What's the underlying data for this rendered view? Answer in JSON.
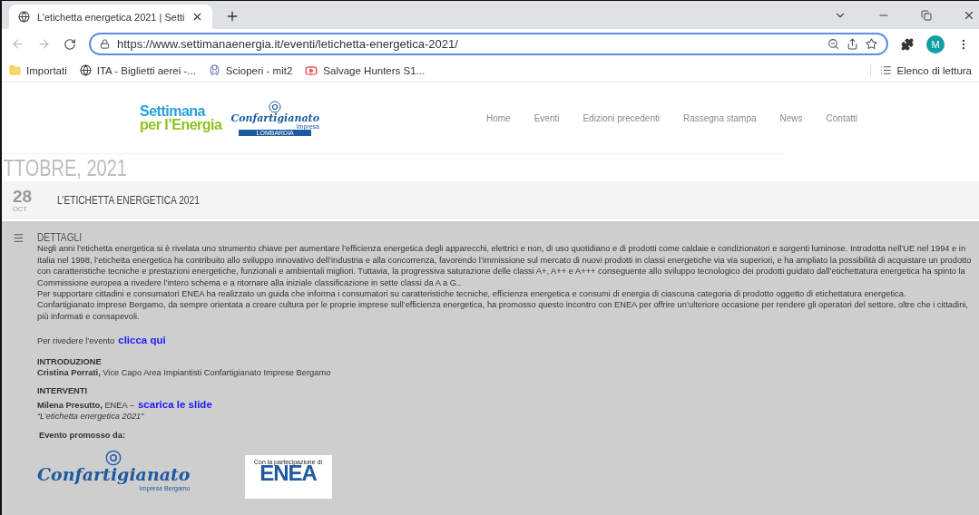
{
  "browser": {
    "tabs": [
      {
        "title": "L’etichetta energetica 2021 | Setti",
        "selected": true
      }
    ],
    "url": "https://www.settimanaenergia.it/eventi/letichetta-energetica-2021/",
    "profile_initial": "M",
    "bookmarks": [
      {
        "kind": "folder",
        "label": "Importati"
      },
      {
        "kind": "globe",
        "label": "ITA - Biglietti aerei -..."
      },
      {
        "kind": "train",
        "label": "Scioperi - mit2"
      },
      {
        "kind": "video",
        "label": "Salvage Hunters S1..."
      }
    ],
    "reading_list": "Elenco di lettura"
  },
  "site": {
    "logo": {
      "line_1": "Settimana",
      "line_2": "per l’Energia",
      "partner": "Confartigianato",
      "partner_sub": "Impresa",
      "partner_region": "LOMBARDIA"
    },
    "nav": [
      "Home",
      "Eventi",
      "Edizioni precedenti",
      "Rassegna stampa",
      "News",
      "Contatti"
    ],
    "month_heading": "TTOBRE, 2021",
    "event": {
      "day": "28",
      "month": "OCT",
      "title": "L’ETICHETTA ENERGETICA 2021"
    },
    "details": {
      "heading": "DETTAGLI",
      "paragraphs": [
        "Negli anni l’etichetta energetica si è rivelata uno strumento chiave per aumentare l’efficienza energetica degli apparecchi, elettrici e non, di uso quotidiano e di prodotti come caldaie e condizionatori e sorgenti luminose. Introdotta nell’UE nel 1994 e in Italia nel 1998, l’etichetta energetica ha contribuito allo sviluppo innovativo dell’industria e alla concorrenza, favorendo l’immissione sul mercato di nuovi prodotti in classi energetiche via via superiori, e ha ampliato la possibilità di acquistare un prodotto con caratteristiche tecniche e prestazioni energetiche, funzionali e ambientali migliori. Tuttavia, la progressiva saturazione delle classi A+, A++ e A+++ conseguente allo sviluppo tecnologico dei prodotti guidato dall’etichettatura energetica ha spinto la Commissione europea a rivedere l’intero schema e a ritornare alla iniziale classificazione in sette classi da A a G..",
        "Per supportare cittadini e consumatori ENEA ha realizzato un guida che informa i consumatori su caratteristiche tecniche, efficienza energetica e consumi di energia di ciascuna categoria di prodotto oggetto di etichettatura energetica.",
        "Confartigianato imprese Bergamo, da sempre orientata a creare cultura per le proprie imprese sull’efficienza energetica, ha promosso questo incontro con ENEA per offrire un’ulteriore occasione per rendere gli operatori del settore, oltre che i cittadini, più informati e consapevoli."
      ],
      "replay_text": "Per rivedere l’evento",
      "replay_link": "clicca qui",
      "intro_heading": "INTRODUZIONE",
      "intro_text": "**Cristina Porrati,** Vice Capo Area Impiantisti Confartigianato Imprese Bergamo",
      "talks_heading": "INTERVENTI",
      "talk_text": "**Milena Presutto,** ENEA –",
      "talk_link": "scarica le slide",
      "talk_title": "“L’etichetta energetica 2021”",
      "promoted_by": "Evento promosso da:",
      "sponsors": {
        "confartigianato": "Confartigianato",
        "confartigianato_sub": "Imprese Bergamo",
        "enea_caption": "Con la partecipazione di",
        "enea": "ENEA"
      }
    }
  }
}
